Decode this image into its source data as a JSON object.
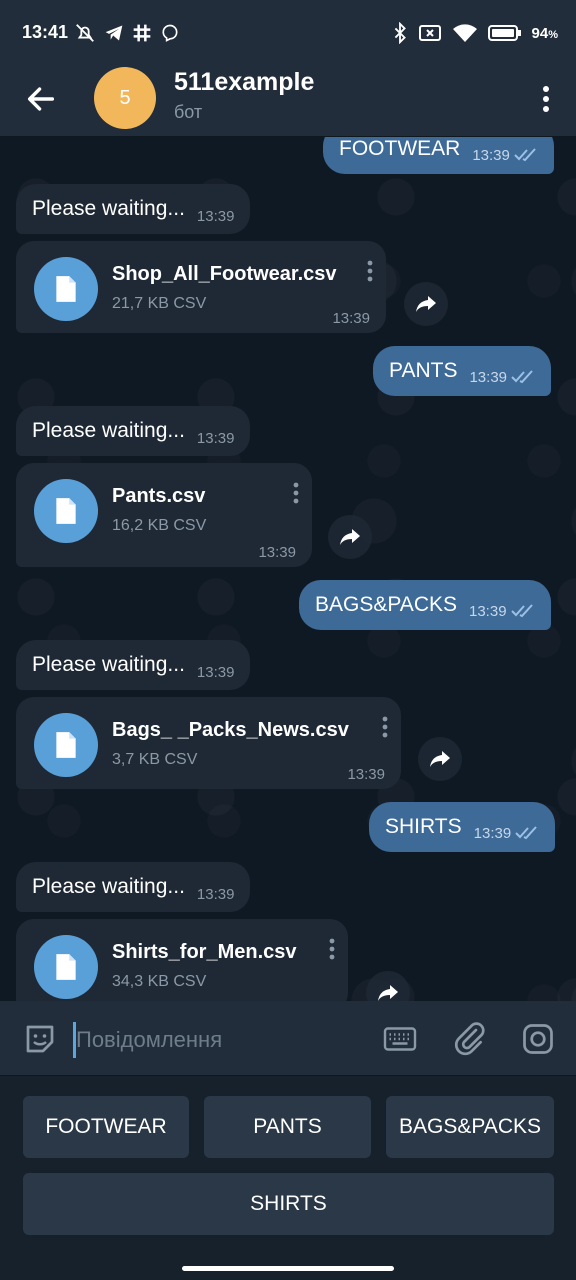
{
  "status_bar": {
    "time": "13:41",
    "battery": "94"
  },
  "header": {
    "avatar_letter": "5",
    "title": "511example",
    "subtitle": "бот"
  },
  "messages": {
    "m1_out": {
      "text": "FOOTWEAR",
      "time": "13:39"
    },
    "m2_in": {
      "text": "Please waiting...",
      "time": "13:39"
    },
    "m3_file": {
      "name": "Shop_All_Footwear.csv",
      "size": "21,7 KB CSV",
      "time": "13:39"
    },
    "m4_out": {
      "text": "PANTS",
      "time": "13:39"
    },
    "m5_in": {
      "text": "Please waiting...",
      "time": "13:39"
    },
    "m6_file": {
      "name": "Pants.csv",
      "size": "16,2 KB CSV",
      "time": "13:39"
    },
    "m7_out": {
      "text": "BAGS&PACKS",
      "time": "13:39"
    },
    "m8_in": {
      "text": "Please waiting...",
      "time": "13:39"
    },
    "m9_file": {
      "name": "Bags_ _Packs_News.csv",
      "size": "3,7 KB CSV",
      "time": "13:39"
    },
    "m10_out": {
      "text": "SHIRTS",
      "time": "13:39"
    },
    "m11_in": {
      "text": "Please waiting...",
      "time": "13:39"
    },
    "m12_file": {
      "name": "Shirts_for_Men.csv",
      "size": "34,3 KB CSV"
    }
  },
  "input": {
    "placeholder": "Повідомлення"
  },
  "reply_keyboard": {
    "b1": "FOOTWEAR",
    "b2": "PANTS",
    "b3": "BAGS&PACKS",
    "b4": "SHIRTS"
  },
  "colors": {
    "header": "#212d3b",
    "outgoing_bubble": "#3e6a98",
    "incoming_bubble": "#1f2936",
    "file_icon": "#5aa0d8",
    "avatar": "#f2b75a",
    "keyboard_button": "#2b3847"
  },
  "icons": {
    "back": "arrow-left-icon",
    "menu": "more-vertical-icon",
    "file": "document-icon",
    "share": "forward-arrow-icon",
    "emoji": "sticker-emoji-icon",
    "keyboard": "keyboard-icon",
    "attach": "paperclip-icon",
    "camera": "instagram-camera-icon"
  }
}
